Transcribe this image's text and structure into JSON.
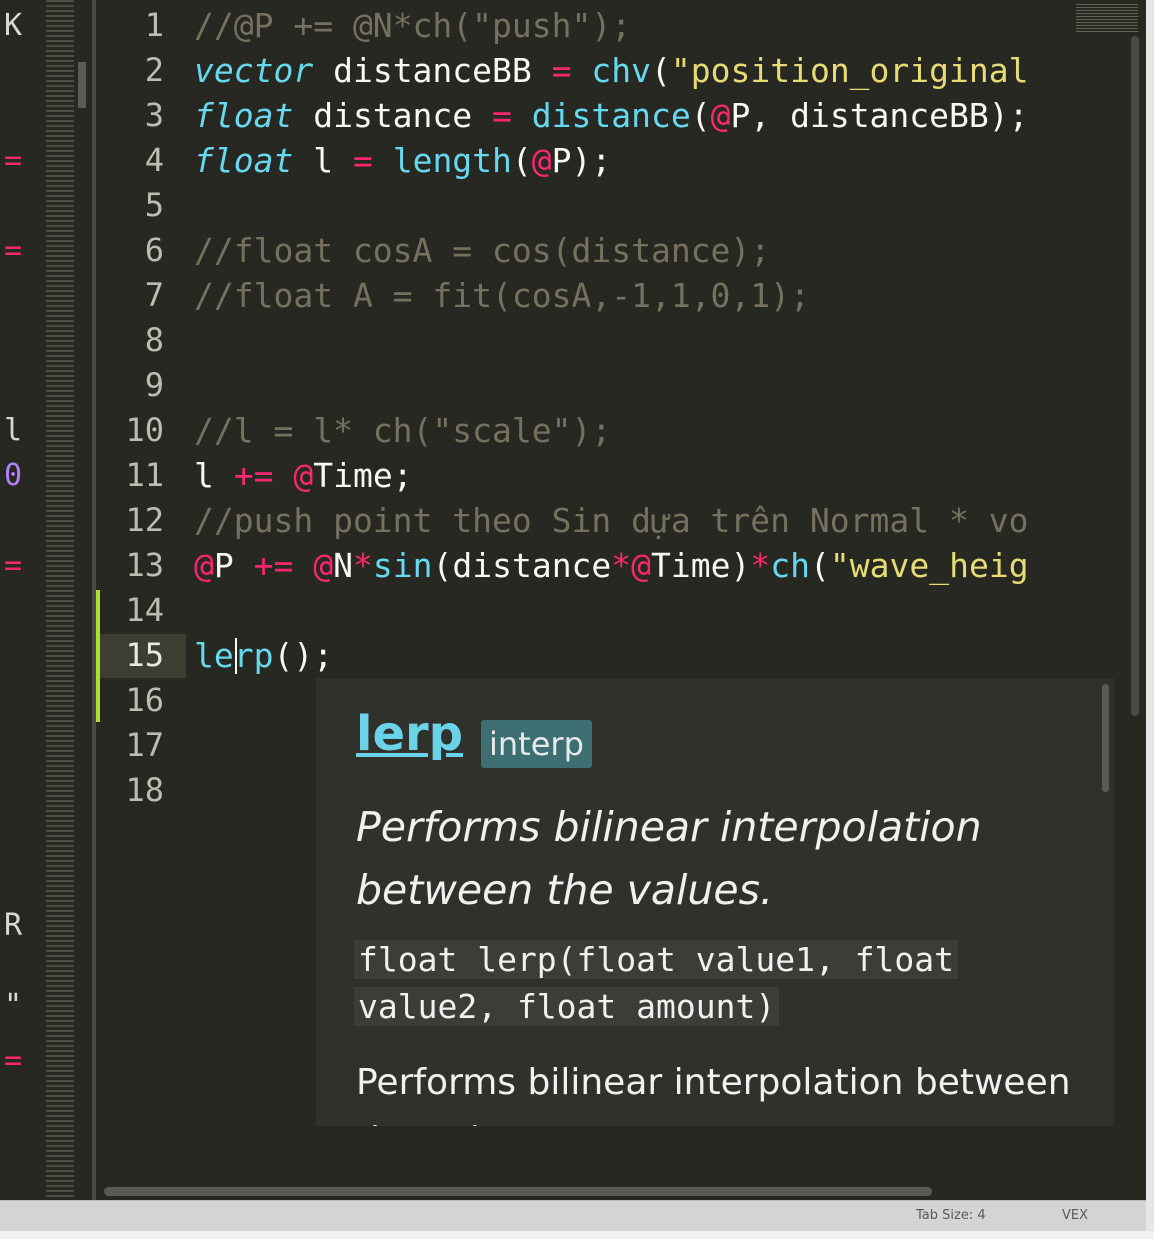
{
  "left_pane": {
    "chars": [
      "K",
      "=",
      "=",
      "l",
      "0",
      "=",
      "R",
      "\"",
      "="
    ]
  },
  "editor": {
    "lines": [
      {
        "num": "1",
        "tokens": [
          {
            "t": "//@P += @N*ch(\"push\");",
            "c": "cm"
          }
        ]
      },
      {
        "num": "2",
        "tokens": [
          {
            "t": "vector",
            "c": "kw"
          },
          {
            "t": " distanceBB ",
            "c": ""
          },
          {
            "t": "=",
            "c": "op"
          },
          {
            "t": " ",
            "c": ""
          },
          {
            "t": "chv",
            "c": "fn"
          },
          {
            "t": "(",
            "c": ""
          },
          {
            "t": "\"position_original",
            "c": "str"
          }
        ]
      },
      {
        "num": "3",
        "tokens": [
          {
            "t": "float",
            "c": "kw"
          },
          {
            "t": " distance ",
            "c": ""
          },
          {
            "t": "=",
            "c": "op"
          },
          {
            "t": " ",
            "c": ""
          },
          {
            "t": "distance",
            "c": "fn"
          },
          {
            "t": "(",
            "c": ""
          },
          {
            "t": "@",
            "c": "at"
          },
          {
            "t": "P, distanceBB);",
            "c": ""
          }
        ]
      },
      {
        "num": "4",
        "tokens": [
          {
            "t": "float",
            "c": "kw"
          },
          {
            "t": " l ",
            "c": ""
          },
          {
            "t": "=",
            "c": "op"
          },
          {
            "t": " ",
            "c": ""
          },
          {
            "t": "length",
            "c": "fn"
          },
          {
            "t": "(",
            "c": ""
          },
          {
            "t": "@",
            "c": "at"
          },
          {
            "t": "P);",
            "c": ""
          }
        ]
      },
      {
        "num": "5",
        "tokens": []
      },
      {
        "num": "6",
        "tokens": [
          {
            "t": "//float cosA = cos(distance);",
            "c": "cm"
          }
        ]
      },
      {
        "num": "7",
        "tokens": [
          {
            "t": "//float A = fit(cosA,-1,1,0,1);",
            "c": "cm"
          }
        ]
      },
      {
        "num": "8",
        "tokens": []
      },
      {
        "num": "9",
        "tokens": []
      },
      {
        "num": "10",
        "tokens": [
          {
            "t": "//l = l* ch(\"scale\");",
            "c": "cm"
          }
        ]
      },
      {
        "num": "11",
        "tokens": [
          {
            "t": "l ",
            "c": ""
          },
          {
            "t": "+=",
            "c": "op"
          },
          {
            "t": " ",
            "c": ""
          },
          {
            "t": "@",
            "c": "at"
          },
          {
            "t": "Time;",
            "c": ""
          }
        ]
      },
      {
        "num": "12",
        "tokens": [
          {
            "t": "//push point theo Sin dựa trên Normal * vo",
            "c": "cm"
          }
        ]
      },
      {
        "num": "13",
        "tokens": [
          {
            "t": "@",
            "c": "at"
          },
          {
            "t": "P ",
            "c": ""
          },
          {
            "t": "+=",
            "c": "op"
          },
          {
            "t": " ",
            "c": ""
          },
          {
            "t": "@",
            "c": "at"
          },
          {
            "t": "N",
            "c": ""
          },
          {
            "t": "*",
            "c": "op"
          },
          {
            "t": "sin",
            "c": "fn"
          },
          {
            "t": "(distance",
            "c": ""
          },
          {
            "t": "*",
            "c": "op"
          },
          {
            "t": "@",
            "c": "at"
          },
          {
            "t": "Time)",
            "c": ""
          },
          {
            "t": "*",
            "c": "op"
          },
          {
            "t": "ch",
            "c": "fn"
          },
          {
            "t": "(",
            "c": ""
          },
          {
            "t": "\"wave_heig",
            "c": "str"
          }
        ]
      },
      {
        "num": "14",
        "tokens": []
      },
      {
        "num": "15",
        "tokens": [
          {
            "t": "lerp",
            "c": "fn"
          },
          {
            "t": "();",
            "c": ""
          }
        ]
      },
      {
        "num": "16",
        "tokens": []
      },
      {
        "num": "17",
        "tokens": []
      },
      {
        "num": "18",
        "tokens": []
      }
    ]
  },
  "popup": {
    "function_name": "lerp",
    "badge": "interp",
    "description": "Performs bilinear interpolation between the values.",
    "signature": "float lerp(float value1, float value2, float amount)",
    "description2": "Performs bilinear interpolation between the values."
  },
  "status": {
    "tab_size": "Tab Size: 4",
    "syntax": "VEX"
  },
  "colors": {
    "background": "#272822",
    "comment": "#75715e",
    "keyword": "#66d9ef",
    "operator": "#f92672",
    "string": "#e6db74",
    "git_added": "#a6e22e"
  }
}
